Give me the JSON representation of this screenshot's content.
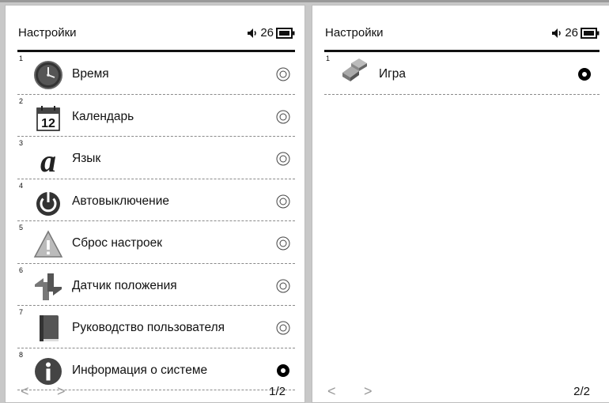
{
  "left": {
    "title": "Настройки",
    "volume": "26",
    "items": [
      {
        "num": "1",
        "label": "Время",
        "selected": false,
        "icon": "clock-icon"
      },
      {
        "num": "2",
        "label": "Календарь",
        "selected": false,
        "icon": "calendar-icon",
        "icon_text": "12"
      },
      {
        "num": "3",
        "label": "Язык",
        "selected": false,
        "icon": "language-icon",
        "icon_text": "a"
      },
      {
        "num": "4",
        "label": "Автовыключение",
        "selected": false,
        "icon": "power-icon"
      },
      {
        "num": "5",
        "label": "Сброс настроек",
        "selected": false,
        "icon": "warning-icon"
      },
      {
        "num": "6",
        "label": "Датчик положения",
        "selected": false,
        "icon": "rotation-icon"
      },
      {
        "num": "7",
        "label": "Руководство пользователя",
        "selected": false,
        "icon": "book-icon"
      },
      {
        "num": "8",
        "label": "Информация о системе",
        "selected": true,
        "icon": "info-icon"
      }
    ],
    "prev": "<",
    "next": ">",
    "page": "1/2"
  },
  "right": {
    "title": "Настройки",
    "volume": "26",
    "items": [
      {
        "num": "1",
        "label": "Игра",
        "selected": true,
        "icon": "game-icon"
      }
    ],
    "prev": "<",
    "next": ">",
    "page": "2/2"
  }
}
